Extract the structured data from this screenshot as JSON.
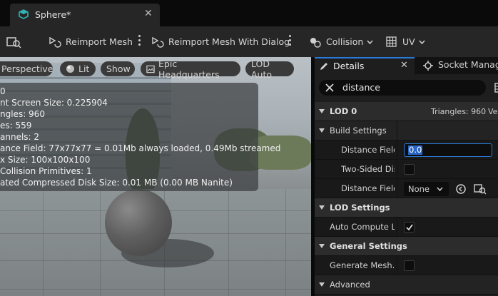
{
  "tab": {
    "title": "Sphere*",
    "close": "✕"
  },
  "toolbar": {
    "reimport_mesh": "Reimport Mesh",
    "reimport_with_dialog": "Reimport Mesh With Dialog",
    "collision": "Collision",
    "uv": "UV"
  },
  "viewport": {
    "buttons": [
      "Perspective",
      "Lit",
      "Show",
      "Epic Headquarters",
      "LOD Auto"
    ],
    "stats": [
      "0",
      "nt Screen Size:  0.225904",
      "ngles:  960",
      "es:  559",
      "annels:  2",
      "ance Field:  77x77x77 = 0.01Mb always loaded, 0.49Mb streamed",
      "x Size: 100x100x100",
      "Collision Primitives:  1",
      "ated Compressed Disk Size: 0.01 MB (0.00 MB Nanite)"
    ]
  },
  "details": {
    "tabs": {
      "details": "Details",
      "socket": "Socket Manag",
      "close": "✕"
    },
    "search": {
      "value": "distance"
    },
    "lod0": {
      "label": "LOD 0",
      "triangles": "Triangles: 960",
      "ve": "Ve"
    },
    "build_settings": "Build Settings",
    "distance_field_label": "Distance Field",
    "distance_field_value": "0.0",
    "two_sided_label": "Two-Sided Dis",
    "distance_field_label2": "Distance Field",
    "none_value": "None",
    "lod_settings": "LOD Settings",
    "auto_compute_label": "Auto Compute LOI",
    "general_settings": "General Settings",
    "generate_mesh_label": "Generate Mesh...",
    "advanced": "Advanced"
  },
  "colors": {
    "accent": "#2a7bd8",
    "tab_cyan": "#2fb3b3"
  }
}
